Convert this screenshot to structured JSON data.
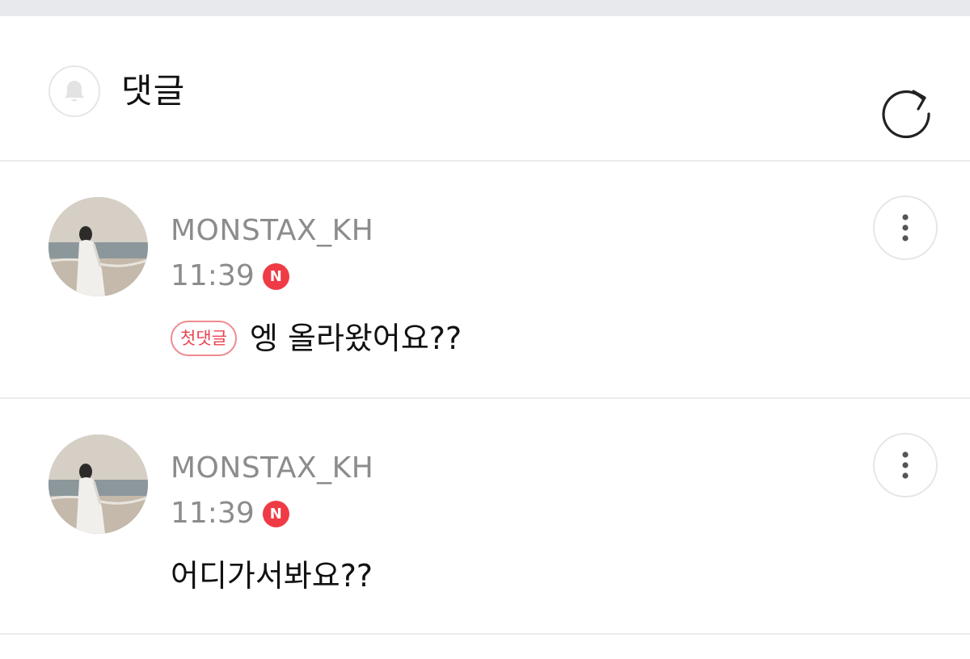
{
  "header": {
    "title": "댓글",
    "bell_icon": "bell-icon",
    "refresh_icon": "refresh-icon"
  },
  "colors": {
    "new_badge": "#ef3b46",
    "first_tag_text": "#ea4450",
    "first_tag_border": "#f08a8f",
    "meta_text": "#8c8c8c"
  },
  "comments": [
    {
      "username": "MONSTAX_KH",
      "time": "11:39",
      "new_badge": "N",
      "tag": "첫댓글",
      "text": "엥 올라왔어요??",
      "more_icon": "more-vertical-icon"
    },
    {
      "username": "MONSTAX_KH",
      "time": "11:39",
      "new_badge": "N",
      "text": "어디가서봐요??",
      "more_icon": "more-vertical-icon"
    }
  ]
}
